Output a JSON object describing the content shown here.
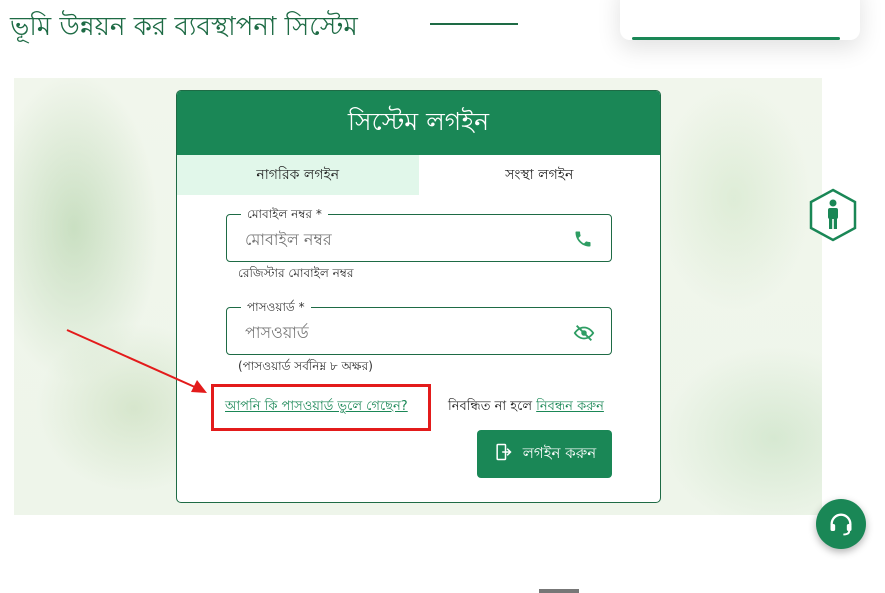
{
  "header": {
    "title": "ভূমি উন্নয়ন কর ব্যবস্থাপনা সিস্টেম"
  },
  "login": {
    "title": "সিস্টেম লগইন",
    "tabs": [
      {
        "label": "নাগরিক লগইন",
        "active": true
      },
      {
        "label": "সংস্থা লগইন",
        "active": false
      }
    ],
    "mobile": {
      "legend": "মোবাইল নম্বর *",
      "placeholder": "মোবাইল নম্বর",
      "helper": "রেজিস্টার মোবাইল নম্বর",
      "icon": "phone-icon"
    },
    "password": {
      "legend": "পাসওয়ার্ড *",
      "placeholder": "পাসওয়ার্ড",
      "helper": "(পাসওয়ার্ড সর্বনিম্ন ৮ অক্ষর)",
      "icon": "eye-slash-icon"
    },
    "forgot_link": "আপনি কি পাসওয়ার্ড ভুলে গেছেন?",
    "register_prefix": "নিবন্ধিত না হলে",
    "register_link": "নিবন্ধন করুন",
    "submit_label": "লগইন করুন",
    "submit_icon": "login-icon"
  },
  "colors": {
    "primary": "#1a8756",
    "active_tab": "#e1f7ea",
    "annotation": "#e31b1b"
  },
  "floating": {
    "accessibility_icon": "accessibility-person-icon",
    "support_icon": "headset-icon"
  }
}
